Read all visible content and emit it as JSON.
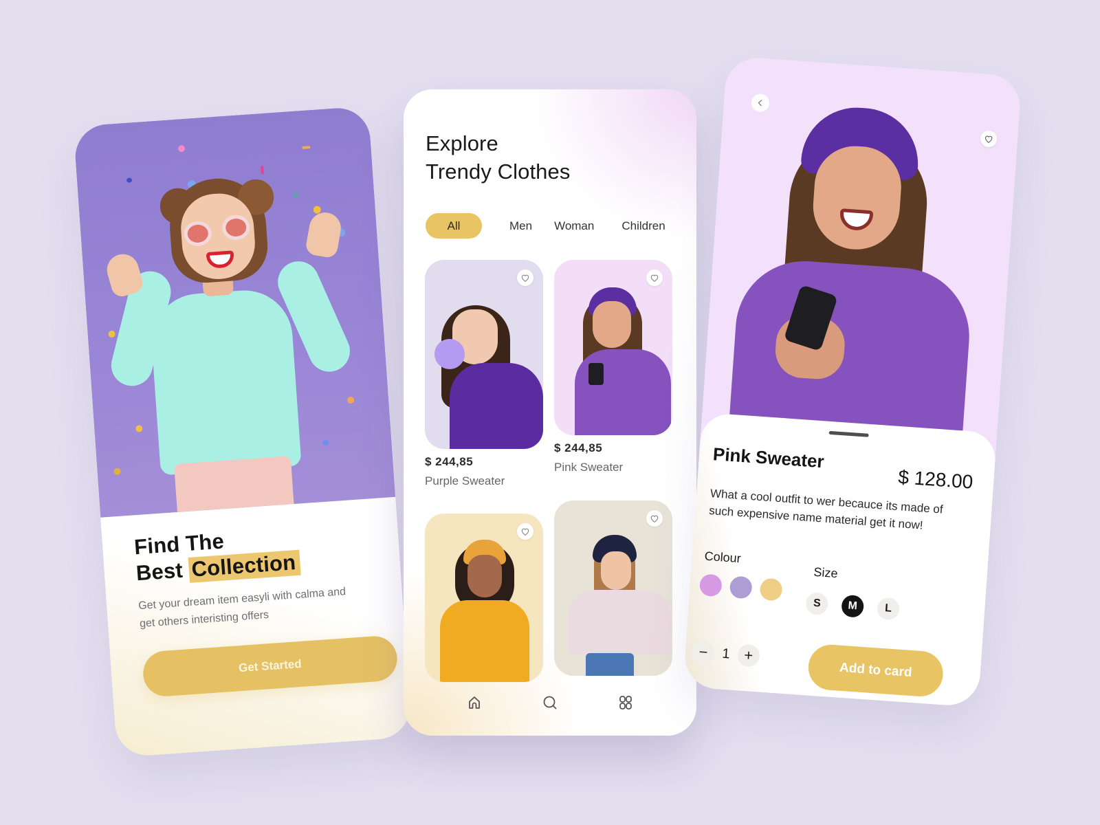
{
  "onboarding": {
    "title_line1": "Find The",
    "title_line2_plain": "Best",
    "title_line2_highlight": "Collection",
    "subtitle": "Get your dream item easyli with calma and get others interisting offers",
    "cta_label": "Get Started"
  },
  "explore": {
    "title_line1": "Explore",
    "title_line2": "Trendy Clothes",
    "categories": [
      {
        "label": "All",
        "active": true
      },
      {
        "label": "Men",
        "active": false
      },
      {
        "label": "Woman",
        "active": false
      },
      {
        "label": "Children",
        "active": false
      }
    ],
    "products": [
      {
        "name": "Purple Sweater",
        "price": "$ 244,85",
        "bg": "#e2dcef"
      },
      {
        "name": "Pink Sweater",
        "price": "$ 244,85",
        "bg": "#f3def8"
      },
      {
        "name": "",
        "price": "",
        "bg": "#f6e6c0"
      },
      {
        "name": "",
        "price": "",
        "bg": "#e7e3d7"
      }
    ],
    "nav": [
      {
        "icon": "home-icon"
      },
      {
        "icon": "search-icon"
      },
      {
        "icon": "grid-icon"
      }
    ]
  },
  "detail": {
    "name": "Pink Sweater",
    "price": "$ 128.00",
    "description": "What a cool outfit  to wer becauce its made of such expensive name material get it now!",
    "colour_label": "Colour",
    "size_label": "Size",
    "colours": [
      "#d69ae5",
      "#ac9dd2",
      "#eecd85"
    ],
    "sizes": [
      {
        "label": "S",
        "selected": false
      },
      {
        "label": "M",
        "selected": true
      },
      {
        "label": "L",
        "selected": false
      }
    ],
    "quantity": "1",
    "decrement_label": "−",
    "increment_label": "+",
    "add_label": "Add to card"
  },
  "colors": {
    "background": "#e3dfef",
    "accent_gold": "#e8c465",
    "hero_purple": "#9a86d6"
  }
}
